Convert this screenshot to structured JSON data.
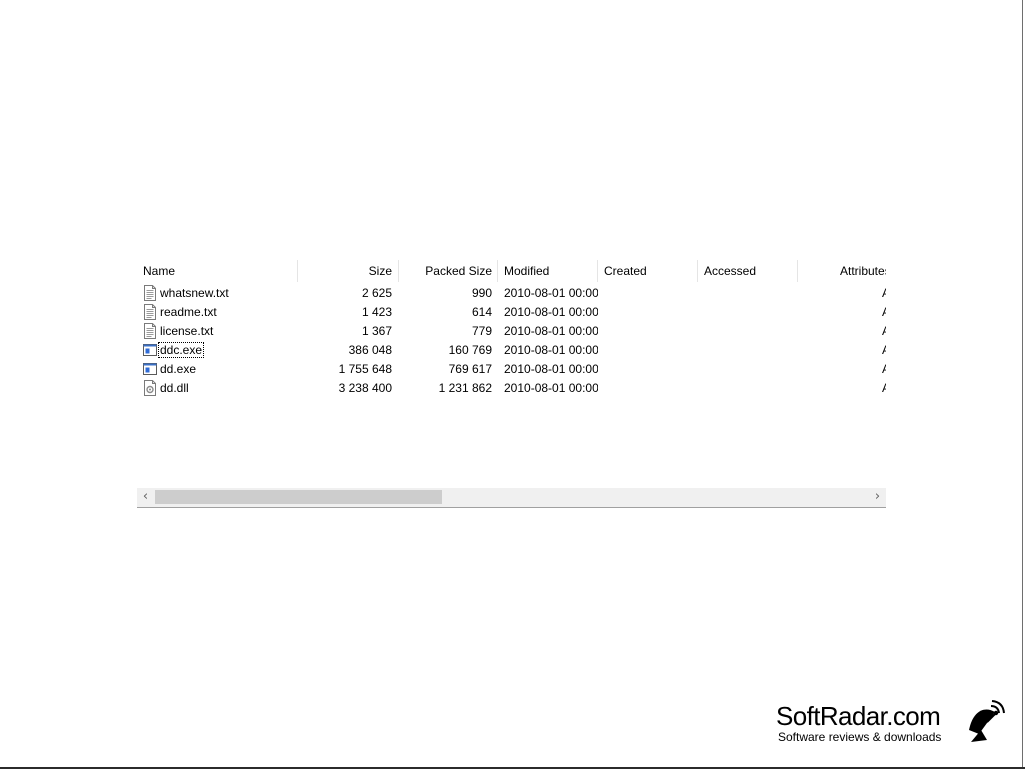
{
  "columns": [
    {
      "label": "Name"
    },
    {
      "label": "Size"
    },
    {
      "label": "Packed Size"
    },
    {
      "label": "Modified"
    },
    {
      "label": "Created"
    },
    {
      "label": "Accessed"
    },
    {
      "label": "Attributes"
    }
  ],
  "files": [
    {
      "name": "whatsnew.txt",
      "size": "2 625",
      "packed": "990",
      "modified": "2010-08-01 00:00",
      "created": "",
      "accessed": "",
      "attributes": "A",
      "icon": "text-file-icon"
    },
    {
      "name": "readme.txt",
      "size": "1 423",
      "packed": "614",
      "modified": "2010-08-01 00:00",
      "created": "",
      "accessed": "",
      "attributes": "A",
      "icon": "text-file-icon"
    },
    {
      "name": "license.txt",
      "size": "1 367",
      "packed": "779",
      "modified": "2010-08-01 00:00",
      "created": "",
      "accessed": "",
      "attributes": "A",
      "icon": "text-file-icon"
    },
    {
      "name": "ddc.exe",
      "size": "386 048",
      "packed": "160 769",
      "modified": "2010-08-01 00:00",
      "created": "",
      "accessed": "",
      "attributes": "A",
      "icon": "executable-icon"
    },
    {
      "name": "dd.exe",
      "size": "1 755 648",
      "packed": "769 617",
      "modified": "2010-08-01 00:00",
      "created": "",
      "accessed": "",
      "attributes": "A",
      "icon": "executable-icon"
    },
    {
      "name": "dd.dll",
      "size": "3 238 400",
      "packed": "1 231 862",
      "modified": "2010-08-01 00:00",
      "created": "",
      "accessed": "",
      "attributes": "A",
      "icon": "dll-file-icon"
    }
  ],
  "focused_row": 3,
  "scrollbar": {
    "left_arrow": "‹",
    "right_arrow": "›",
    "position_percent": 0
  },
  "watermark": {
    "title": "SoftRadar.com",
    "subtitle": "Software reviews & downloads",
    "icon": "satellite-dish-icon"
  }
}
